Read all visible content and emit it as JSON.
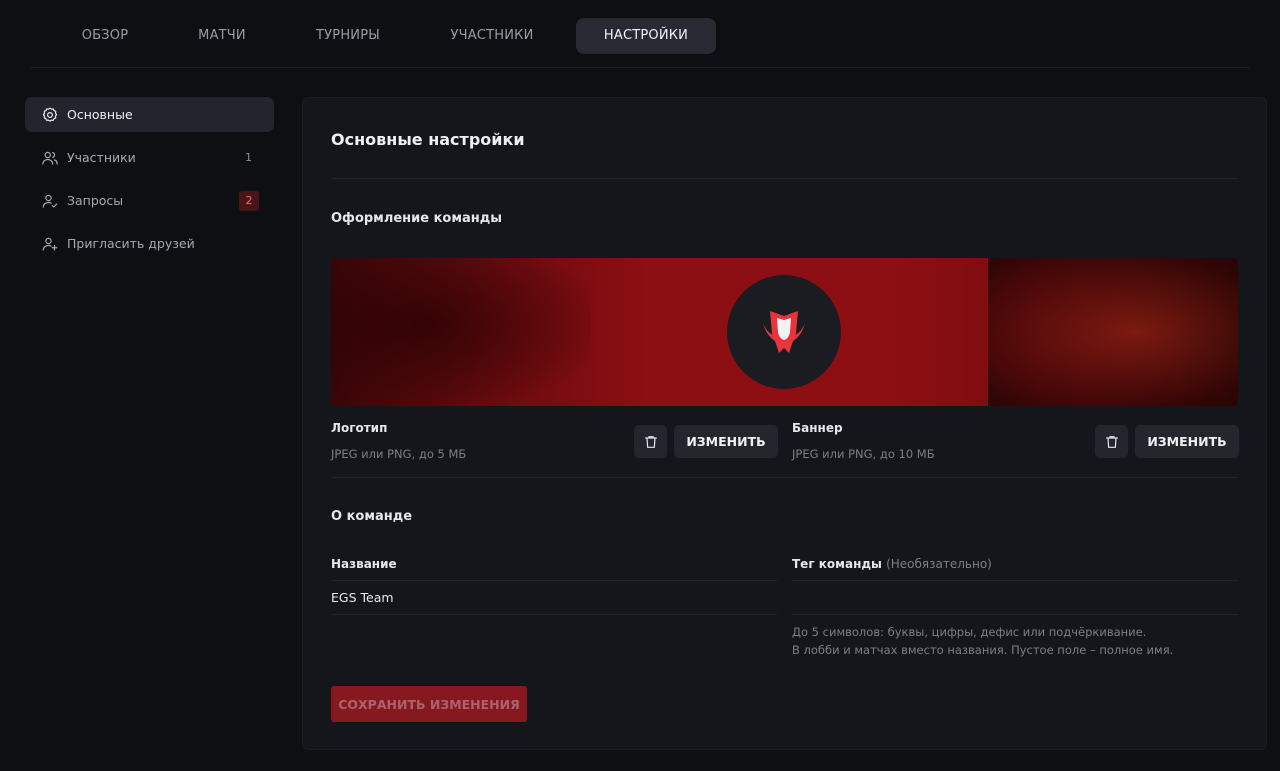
{
  "tabs": [
    {
      "label": "ОБЗОР"
    },
    {
      "label": "МАТЧИ"
    },
    {
      "label": "ТУРНИРЫ"
    },
    {
      "label": "УЧАСТНИКИ"
    },
    {
      "label": "НАСТРОЙКИ",
      "active": true
    }
  ],
  "sidebar": {
    "items": [
      {
        "label": "Основные",
        "icon": "gear-icon",
        "active": true
      },
      {
        "label": "Участники",
        "icon": "users-icon",
        "count": "1"
      },
      {
        "label": "Запросы",
        "icon": "user-check-icon",
        "badge": "2"
      },
      {
        "label": "Пригласить друзей",
        "icon": "user-plus-icon"
      }
    ]
  },
  "panel": {
    "title": "Основные настройки",
    "design_section": "Оформление команды",
    "logo": {
      "label": "Логотип",
      "hint": "JPEG или PNG, до 5 МБ",
      "change_label": "ИЗМЕНИТЬ"
    },
    "banner": {
      "label": "Баннер",
      "hint": "JPEG или PNG, до 10 МБ",
      "change_label": "ИЗМЕНИТЬ"
    },
    "about_section": "О команде",
    "name_field": {
      "label": "Название",
      "value": "EGS Team"
    },
    "tag_field": {
      "label": "Тег команды",
      "optional": "(Необязательно)",
      "value": "",
      "hint_line1": "До 5 символов: буквы, цифры, дефис или подчёркивание.",
      "hint_line2": "В лобби и матчах вместо названия. Пустое поле – полное имя."
    },
    "save_label": "СОХРАНИТЬ ИЗМЕНЕНИЯ"
  },
  "colors": {
    "background": "#0e0f13",
    "panel": "#15161b",
    "accent_red": "#e3323a",
    "save_button": "#9a1a21"
  }
}
